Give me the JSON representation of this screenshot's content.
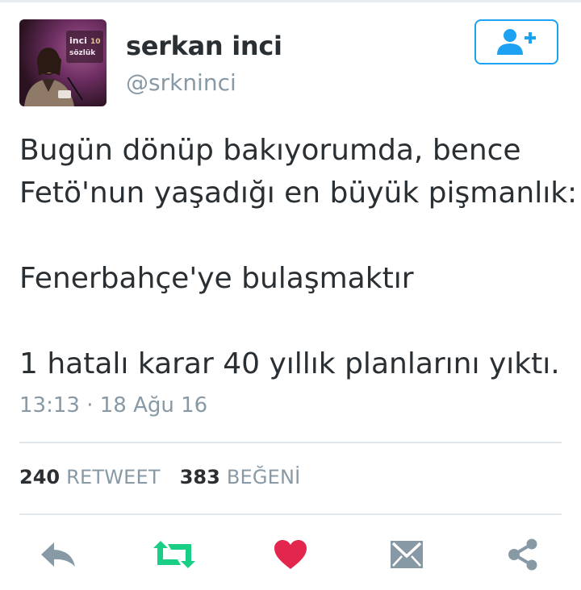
{
  "user": {
    "display_name": "serkan inci",
    "handle": "@srkninci",
    "avatar_alt": "profile photo"
  },
  "follow_button": {
    "icon": "follow-user-icon"
  },
  "tweet": {
    "lines": [
      "Bugün dönüp bakıyorumda, bence",
      "Fetö'nun yaşadığı en büyük pişmanlık:",
      "",
      "Fenerbahçe'ye bulaşmaktır",
      "",
      "1 hatalı karar 40 yıllık planlarını yıktı."
    ],
    "timestamp": "13:13 · 18 Ağu 16"
  },
  "stats": {
    "retweet_count": "240",
    "retweet_label": "RETWEET",
    "like_count": "383",
    "like_label": "BEĞENİ"
  },
  "actions": [
    {
      "name": "reply-icon",
      "color": "#8899a6"
    },
    {
      "name": "retweet-icon",
      "color": "#19cf86"
    },
    {
      "name": "heart-icon",
      "color": "#e2264d"
    },
    {
      "name": "message-icon",
      "color": "#8899a6"
    },
    {
      "name": "share-icon",
      "color": "#8899a6"
    }
  ],
  "colors": {
    "accent": "#1da1f2",
    "text": "#292f33",
    "muted": "#8899a6",
    "divider": "#e1e8ed"
  }
}
